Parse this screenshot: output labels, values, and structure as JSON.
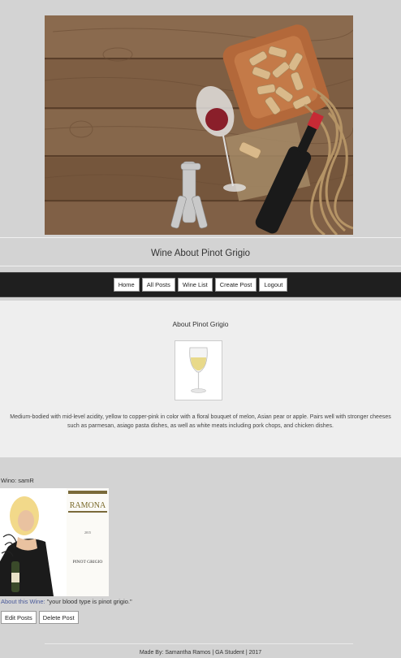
{
  "header": {
    "site_title": "Wine About Pinot Grigio"
  },
  "nav": {
    "items": [
      {
        "label": "Home"
      },
      {
        "label": "All Posts"
      },
      {
        "label": "Wine List"
      },
      {
        "label": "Create Post"
      },
      {
        "label": "Logout"
      }
    ]
  },
  "about": {
    "title": "About Pinot Grigio",
    "description": "Medium-bodied with mid-level acidity, yellow to copper-pink in color with a floral bouquet of melon, Asian pear or apple. Pairs well with stronger cheeses such as parmesan, asiago pasta dishes, as well as white meats including pork chops, and chicken dishes."
  },
  "post": {
    "wino_label": "Wino: samR",
    "bottle_brand": "RAMONA",
    "bottle_year": "2015",
    "bottle_type": "PINOT GRIGIO",
    "about_label": "About this Wine:",
    "about_text": "\"your blood type is pinot grigio.\"",
    "edit_label": "Edit Posts",
    "delete_label": "Delete Post"
  },
  "footer": {
    "text": "Made By: Samantha Ramos | GA Student | 2017"
  },
  "colors": {
    "page_bg": "#d3d3d3",
    "navbar_bg": "#1f1f1f",
    "section_bg": "#eeeeee",
    "link": "#4a5a9a",
    "wine_red": "#c62a35"
  }
}
